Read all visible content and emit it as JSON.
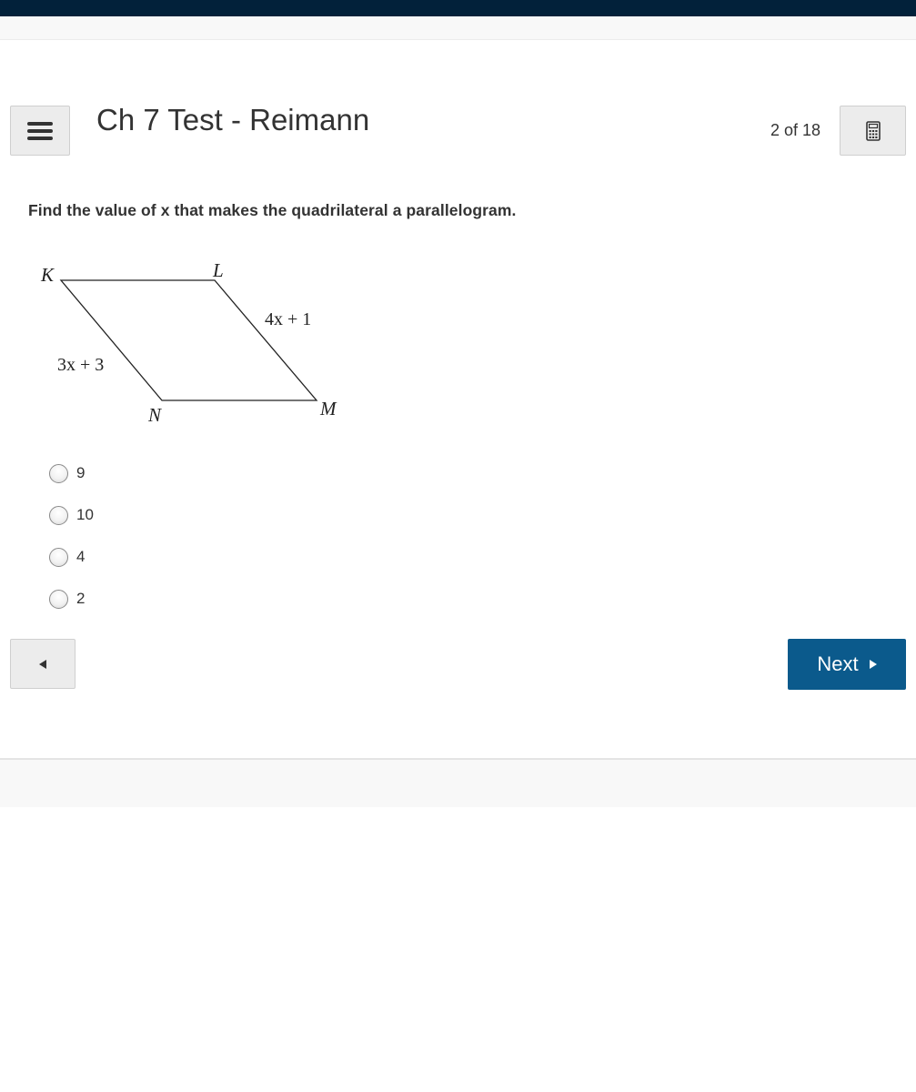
{
  "header": {
    "title": "Ch 7 Test - Reimann",
    "progress": "2 of 18"
  },
  "question": {
    "prompt": "Find the value of x that makes the quadrilateral a parallelogram.",
    "figure": {
      "vertices": [
        "K",
        "L",
        "M",
        "N"
      ],
      "side_labels": {
        "LM": "4x + 1",
        "KN": "3x + 3"
      }
    },
    "options": [
      {
        "label": "9",
        "selected": false
      },
      {
        "label": "10",
        "selected": false
      },
      {
        "label": "4",
        "selected": false
      },
      {
        "label": "2",
        "selected": false
      }
    ]
  },
  "navigation": {
    "next_label": "Next"
  },
  "icons": {
    "menu": "hamburger-menu-icon",
    "calculator": "calculator-icon",
    "prev": "triangle-left-icon",
    "next": "triangle-right-icon"
  },
  "colors": {
    "top_bar": "#02213a",
    "next_button": "#0b5a8c",
    "button_gray": "#ececec"
  }
}
